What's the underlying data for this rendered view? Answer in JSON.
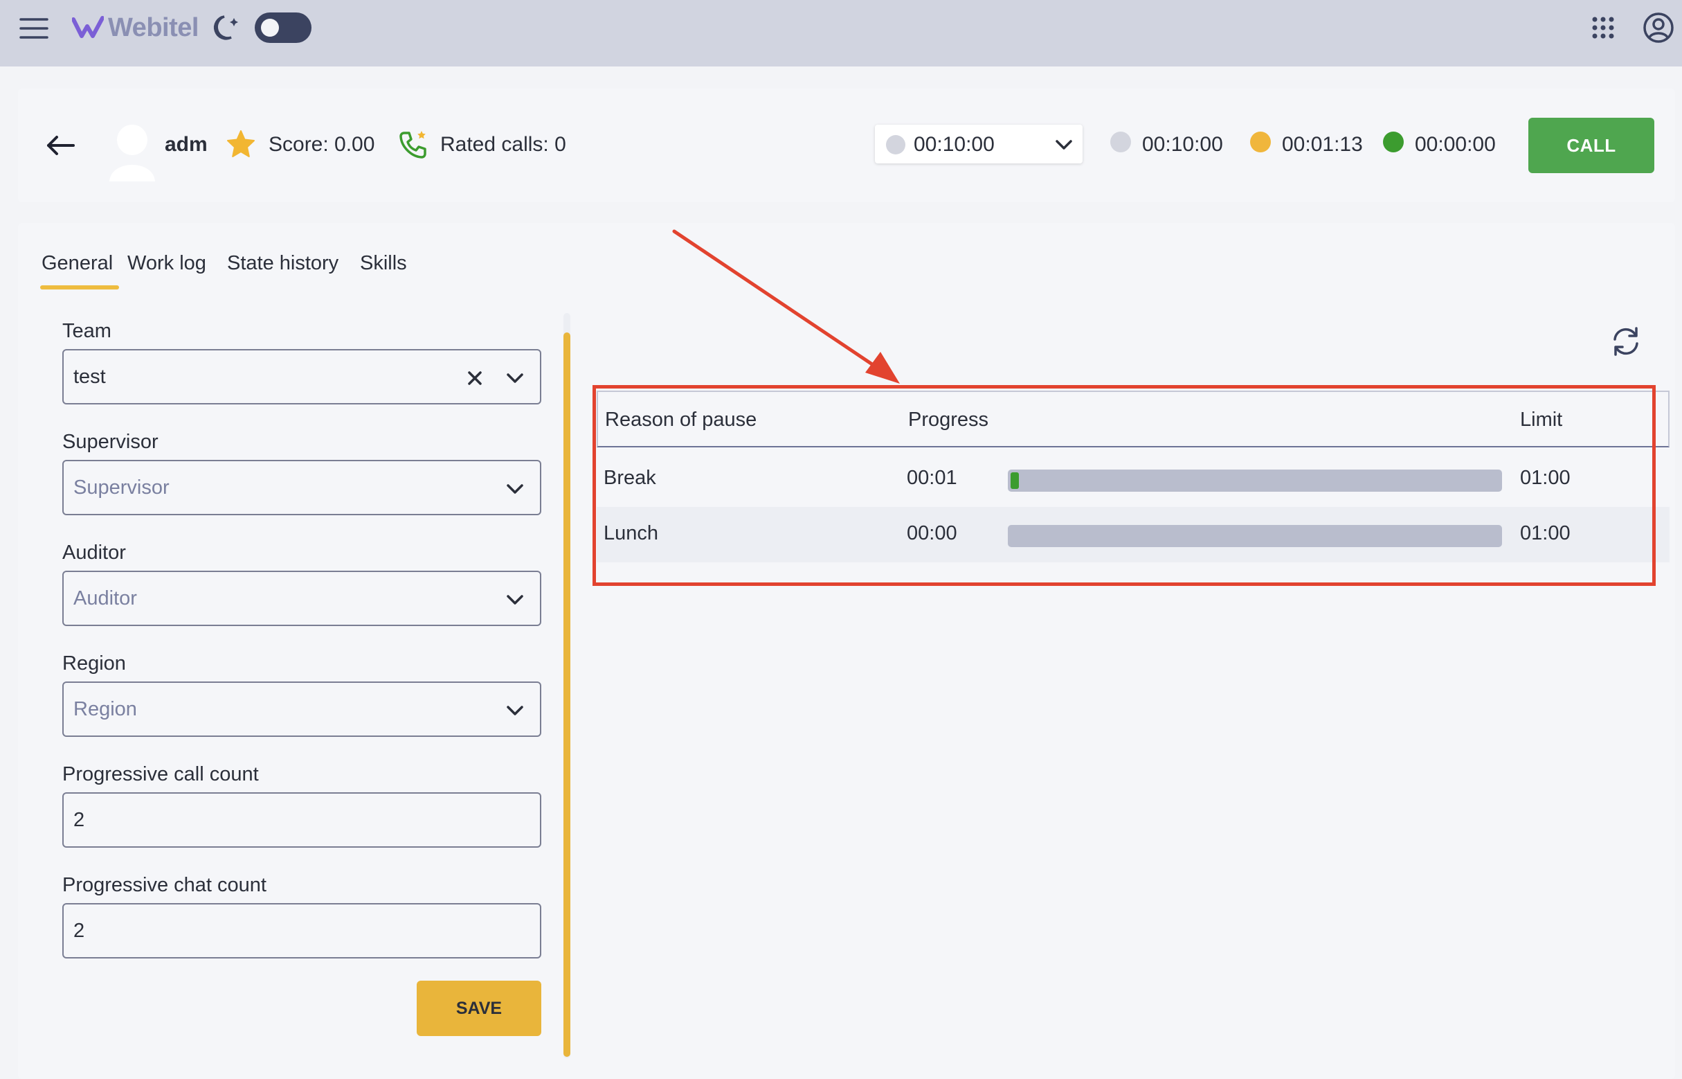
{
  "topbar": {
    "logo_text": "Webitel",
    "icons": [
      "menu-icon",
      "webitel-logo",
      "moon-icon",
      "apps-grid-icon",
      "account-icon"
    ],
    "theme_toggle_on": false
  },
  "header": {
    "user_name": "adm",
    "score_label": "Score: 0.00",
    "rated_calls_label": "Rated calls: 0",
    "status_select_value": "00:10:00",
    "timers": [
      {
        "value": "00:10:00",
        "color": "#d3d5de"
      },
      {
        "value": "00:01:13",
        "color": "#f0b63c"
      },
      {
        "value": "00:00:00",
        "color": "#3c9c2f"
      }
    ],
    "call_button": "CALL"
  },
  "tabs": [
    {
      "label": "General",
      "active": true
    },
    {
      "label": "Work log",
      "active": false
    },
    {
      "label": "State history",
      "active": false
    },
    {
      "label": "Skills",
      "active": false
    }
  ],
  "form": {
    "team": {
      "label": "Team",
      "value": "test"
    },
    "supervisor": {
      "label": "Supervisor",
      "placeholder": "Supervisor"
    },
    "auditor": {
      "label": "Auditor",
      "placeholder": "Auditor"
    },
    "region": {
      "label": "Region",
      "placeholder": "Region"
    },
    "progressive_call_count": {
      "label": "Progressive call count",
      "value": "2"
    },
    "progressive_chat_count": {
      "label": "Progressive chat count",
      "value": "2"
    },
    "save_button": "SAVE"
  },
  "pause_table": {
    "headers": {
      "reason": "Reason of pause",
      "progress": "Progress",
      "limit": "Limit"
    },
    "rows": [
      {
        "reason": "Break",
        "duration": "00:01",
        "limit": "01:00",
        "progress_fraction": 0.017
      },
      {
        "reason": "Lunch",
        "duration": "00:00",
        "limit": "01:00",
        "progress_fraction": 0
      }
    ]
  },
  "colors": {
    "accent": "#e9b53b",
    "call_green": "#4fa64f",
    "annotation_red": "#e2432f",
    "topbar_bg": "#d1d4e0"
  }
}
